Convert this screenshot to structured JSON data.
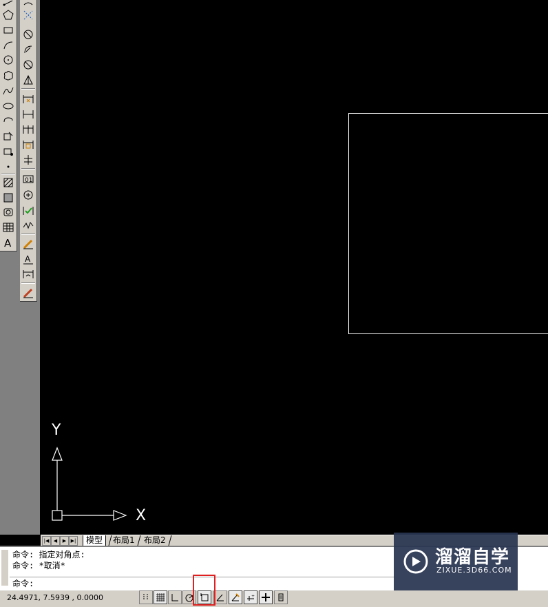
{
  "ucs": {
    "y_label": "Y",
    "x_label": "X"
  },
  "tabs": [
    {
      "label": "模型",
      "active": true
    },
    {
      "label": "布局1",
      "active": false
    },
    {
      "label": "布局2",
      "active": false
    }
  ],
  "command": {
    "history": [
      "命令: 指定对角点:",
      "命令: *取消*"
    ],
    "prompt": "命令:"
  },
  "status": {
    "coordinates": "24.4971, 7.5939 , 0.0000"
  },
  "draw_toolbar": [
    "line-icon",
    "polygon-icon",
    "rectangle-icon",
    "arc-icon",
    "circle-icon",
    "revcloud-icon",
    "spline-icon",
    "ellipse-icon",
    "ellipse-arc-icon",
    "insert-block-icon",
    "make-block-icon",
    "point-icon",
    "hatch-icon",
    "gradient-icon",
    "region-icon",
    "table-icon",
    "multiline-text-icon"
  ],
  "dimension_toolbar": [
    "linear-dim-icon",
    "aligned-dim-icon",
    "arc-length-dim-icon",
    "ordinate-dim-icon",
    "radius-dim-icon",
    "jogged-dim-icon",
    "diameter-dim-icon",
    "angular-dim-icon",
    "quick-dim-icon",
    "baseline-dim-icon",
    "continue-dim-icon",
    "quick-leader-icon",
    "tolerance-icon",
    "center-mark-icon",
    "inspection-icon",
    "jogged-linear-icon",
    "dim-edit-icon",
    "dim-text-edit-icon",
    "dim-update-icon",
    "dim-style-icon"
  ],
  "status_toggles": [
    "snap",
    "grid",
    "ortho",
    "polar",
    "osnap",
    "otrack",
    "ducs",
    "dyn",
    "lwt",
    "model"
  ],
  "colors": {
    "canvas": "#000000",
    "toolbar": "#d4d0c8",
    "highlight": "#e02020",
    "watermark": "#283450"
  },
  "watermark": {
    "title": "溜溜自学",
    "subtitle": "ZIXUE.3D66.COM"
  }
}
